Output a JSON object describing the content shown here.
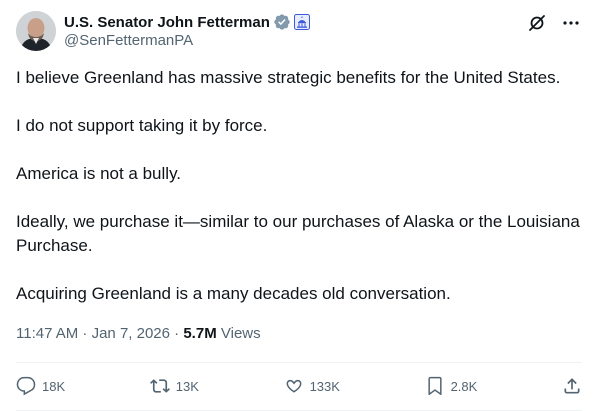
{
  "author": {
    "display_name": "U.S. Senator John Fetterman",
    "handle": "@SenFettermanPA"
  },
  "icons": {
    "verified": "verified-badge-icon",
    "affiliation": "capitol-icon",
    "grok": "grok-icon",
    "more": "more-icon"
  },
  "colors": {
    "verified_badge": "#829aab",
    "affiliation_badge": "#3b5bdb",
    "text_primary": "#0f1419",
    "text_secondary": "#536471",
    "divider": "#eff3f4"
  },
  "tweet": {
    "paragraphs": [
      "I believe Greenland has massive strategic benefits for the United States.",
      "I do not support taking it by force.",
      "America is not a bully.",
      "Ideally, we purchase it—similar to our purchases of Alaska or the Louisiana Purchase.",
      "Acquiring Greenland is a many decades old conversation."
    ],
    "timestamp": "11:47 AM · Jan 7, 2026",
    "separator": "·",
    "views_count": "5.7M",
    "views_label": "Views"
  },
  "actions": {
    "replies": "18K",
    "reposts": "13K",
    "likes": "133K",
    "bookmarks": "2.8K"
  }
}
